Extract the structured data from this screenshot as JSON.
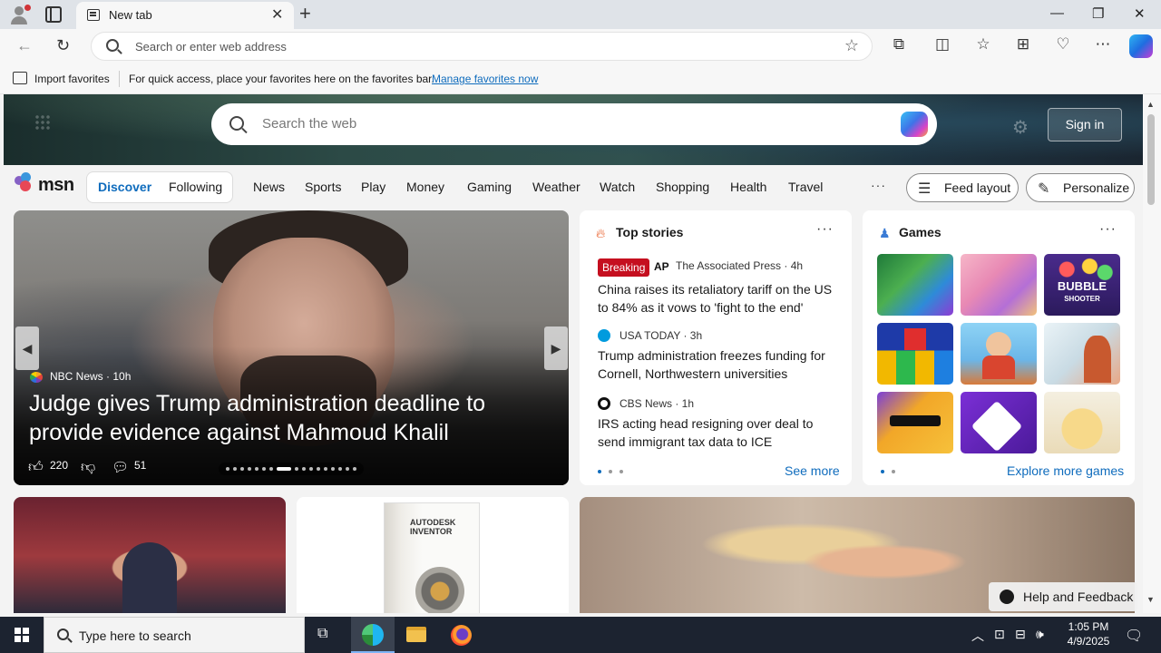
{
  "browser": {
    "tab_title": "New tab",
    "omnibox_placeholder": "Search or enter web address",
    "favorites_bar": {
      "import_label": "Import favorites",
      "message": "For quick access, place your favorites here on the favorites bar.",
      "manage_link": "Manage favorites now"
    }
  },
  "msn": {
    "search_placeholder": "Search the web",
    "sign_in": "Sign in",
    "logo_text": "msn",
    "tabs": {
      "discover": "Discover",
      "following": "Following"
    },
    "nav": [
      "News",
      "Sports",
      "Play",
      "Money",
      "Gaming",
      "Weather",
      "Watch",
      "Shopping",
      "Health",
      "Travel"
    ],
    "more": "···",
    "feed_layout": "Feed layout",
    "personalize": "Personalize",
    "hero": {
      "source": "NBC News · 10h",
      "title": "Judge gives Trump administration deadline to provide evidence against Mahmoud Khalil",
      "likes": "220",
      "comments": "51"
    },
    "top_stories": {
      "heading": "Top stories",
      "stories": [
        {
          "badge": "Breaking",
          "source": "The Associated Press · 4h",
          "title": "China raises its retaliatory tariff on the US to 84% as it vows to 'fight to the end'"
        },
        {
          "source": "USA TODAY · 3h",
          "title": "Trump administration freezes funding for Cornell, Northwestern universities"
        },
        {
          "source": "CBS News · 1h",
          "title": "IRS acting head resigning over deal to send immigrant tax data to ICE"
        }
      ],
      "see_more": "See more"
    },
    "games": {
      "heading": "Games",
      "explore": "Explore more games",
      "bubble_line1": "BUBBLE",
      "bubble_line2": "SHOOTER"
    },
    "help_feedback": "Help and Feedback",
    "inventor_label": "AUTODESK INVENTOR"
  },
  "taskbar": {
    "search_placeholder": "Type here to search",
    "time": "1:05 PM",
    "date": "4/9/2025"
  }
}
